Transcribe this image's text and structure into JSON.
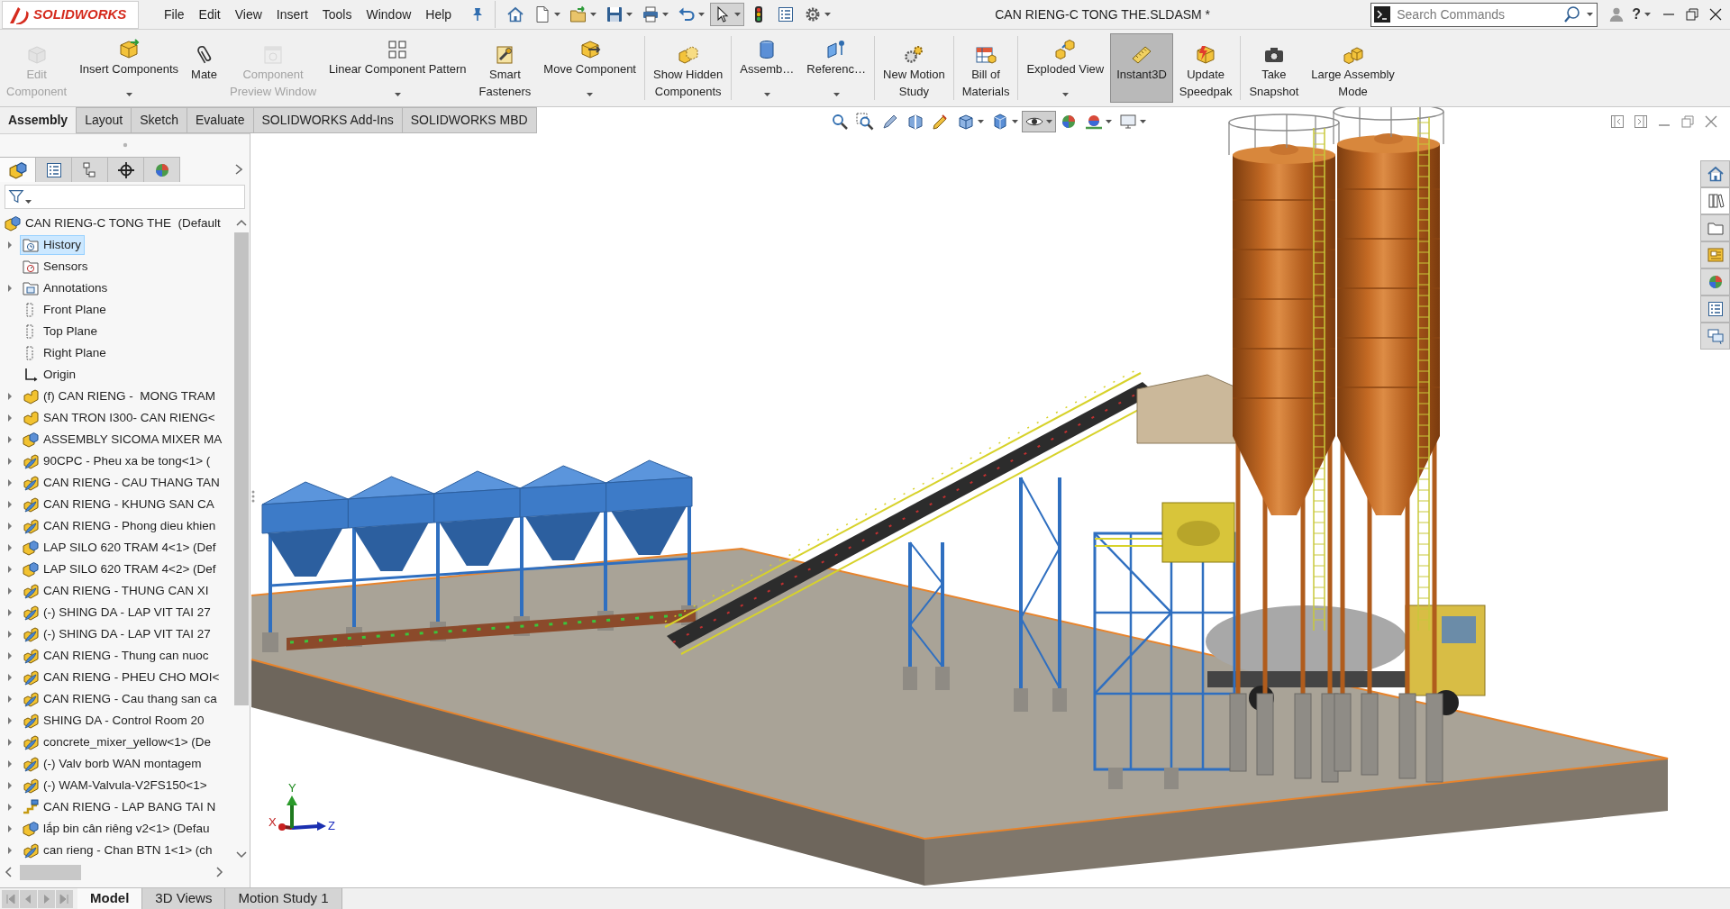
{
  "app": {
    "logo": "SOLIDWORKS",
    "menu": [
      "File",
      "Edit",
      "View",
      "Insert",
      "Tools",
      "Window",
      "Help"
    ],
    "title": "CAN RIENG-C TONG THE.SLDASM *",
    "search": {
      "placeholder": "Search Commands"
    },
    "help": "?"
  },
  "quick_access": [
    {
      "selected": false,
      "menu": false
    },
    {
      "selected": false,
      "menu": true
    },
    {
      "selected": false,
      "menu": true
    },
    {
      "selected": false,
      "menu": true
    },
    {
      "selected": false,
      "menu": true
    },
    {
      "selected": false,
      "menu": true
    },
    {
      "selected": true,
      "menu": true
    },
    {
      "selected": false,
      "menu": false
    },
    {
      "selected": false,
      "menu": false
    },
    {
      "selected": false,
      "menu": true
    }
  ],
  "ribbon": {
    "groups": [
      [
        {
          "label": "Edit\nComponent",
          "disabled": true,
          "selected": false,
          "menu": false
        },
        {
          "label": "Insert Components",
          "disabled": false,
          "selected": false,
          "menu": true
        },
        {
          "label": "Mate",
          "disabled": false,
          "selected": false,
          "menu": false
        },
        {
          "label": "Component\nPreview Window",
          "disabled": true,
          "selected": false,
          "menu": false
        },
        {
          "label": "Linear Component Pattern",
          "disabled": false,
          "selected": false,
          "menu": true
        },
        {
          "label": "Smart\nFasteners",
          "disabled": false,
          "selected": false,
          "menu": false
        },
        {
          "label": "Move Component",
          "disabled": false,
          "selected": false,
          "menu": true
        }
      ],
      [
        {
          "label": "Show Hidden\nComponents",
          "disabled": false,
          "selected": false,
          "menu": false
        }
      ],
      [
        {
          "label": "Assemb…",
          "disabled": false,
          "selected": false,
          "menu": true
        },
        {
          "label": "Referenc…",
          "disabled": false,
          "selected": false,
          "menu": true
        }
      ],
      [
        {
          "label": "New Motion\nStudy",
          "disabled": false,
          "selected": false,
          "menu": false
        }
      ],
      [
        {
          "label": "Bill of\nMaterials",
          "disabled": false,
          "selected": false,
          "menu": false
        }
      ],
      [
        {
          "label": "Exploded View",
          "disabled": false,
          "selected": false,
          "menu": true
        },
        {
          "label": "Instant3D",
          "disabled": false,
          "selected": true,
          "menu": false
        },
        {
          "label": "Update\nSpeedpak",
          "disabled": false,
          "selected": false,
          "menu": false
        }
      ],
      [
        {
          "label": "Take\nSnapshot",
          "disabled": false,
          "selected": false,
          "menu": false
        },
        {
          "label": "Large Assembly\nMode",
          "disabled": false,
          "selected": false,
          "menu": false
        }
      ]
    ],
    "tabs": [
      {
        "label": "Assembly",
        "selected": true
      },
      {
        "label": "Layout",
        "selected": false
      },
      {
        "label": "Sketch",
        "selected": false
      },
      {
        "label": "Evaluate",
        "selected": false
      },
      {
        "label": "SOLIDWORKS Add-Ins",
        "selected": false
      },
      {
        "label": "SOLIDWORKS MBD",
        "selected": false
      }
    ]
  },
  "view_toolbar": [
    {
      "selected": false,
      "menu": false
    },
    {
      "selected": false,
      "menu": false
    },
    {
      "selected": false,
      "menu": false
    },
    {
      "selected": false,
      "menu": false
    },
    {
      "selected": false,
      "menu": false
    },
    {
      "selected": false,
      "menu": true
    },
    {
      "selected": false,
      "menu": true
    },
    {
      "selected": true,
      "menu": true
    },
    {
      "selected": false,
      "menu": false
    },
    {
      "selected": false,
      "menu": true
    },
    {
      "selected": false,
      "menu": true
    }
  ],
  "feature_panel": {
    "tabs": [
      {
        "selected": true
      },
      {
        "selected": false
      },
      {
        "selected": false
      },
      {
        "selected": false
      },
      {
        "selected": false
      }
    ],
    "tree": {
      "label": "CAN RIENG-C TONG THE  (Default",
      "kind": "assembly",
      "expandable": false,
      "selected": false,
      "children": [
        {
          "label": "History",
          "kind": "history",
          "expandable": true,
          "selected": true
        },
        {
          "label": "Sensors",
          "kind": "sensors",
          "expandable": false,
          "selected": false
        },
        {
          "label": "Annotations",
          "kind": "annotations",
          "expandable": true,
          "selected": false
        },
        {
          "label": "Front Plane",
          "kind": "plane",
          "expandable": false,
          "selected": false
        },
        {
          "label": "Top Plane",
          "kind": "plane",
          "expandable": false,
          "selected": false
        },
        {
          "label": "Right Plane",
          "kind": "plane",
          "expandable": false,
          "selected": false
        },
        {
          "label": "Origin",
          "kind": "origin",
          "expandable": false,
          "selected": false
        },
        {
          "label": "(f) CAN RIENG -  MONG TRAM",
          "kind": "part",
          "expandable": true,
          "selected": false
        },
        {
          "label": "SAN TRON I300- CAN RIENG<",
          "kind": "part",
          "expandable": true,
          "selected": false
        },
        {
          "label": "ASSEMBLY SICOMA MIXER MA",
          "kind": "assembly",
          "expandable": true,
          "selected": false
        },
        {
          "label": "90CPC - Pheu xa be tong<1> (",
          "kind": "subassembly",
          "expandable": true,
          "selected": false
        },
        {
          "label": "CAN RIENG - CAU THANG TAN",
          "kind": "subassembly",
          "expandable": true,
          "selected": false
        },
        {
          "label": "CAN RIENG - KHUNG SAN CA",
          "kind": "subassembly",
          "expandable": true,
          "selected": false
        },
        {
          "label": "CAN RIENG - Phong dieu khien",
          "kind": "subassembly",
          "expandable": true,
          "selected": false
        },
        {
          "label": "LAP SILO 620 TRAM 4<1> (Def",
          "kind": "assembly",
          "expandable": true,
          "selected": false
        },
        {
          "label": "LAP SILO 620 TRAM 4<2> (Def",
          "kind": "assembly",
          "expandable": true,
          "selected": false
        },
        {
          "label": "CAN RIENG - THUNG CAN XI",
          "kind": "subassembly",
          "expandable": true,
          "selected": false
        },
        {
          "label": "(-) SHING DA - LAP VIT TAI 27",
          "kind": "subassembly",
          "expandable": true,
          "selected": false
        },
        {
          "label": "(-) SHING DA - LAP VIT TAI 27",
          "kind": "subassembly",
          "expandable": true,
          "selected": false
        },
        {
          "label": "CAN RIENG - Thung can nuoc",
          "kind": "subassembly",
          "expandable": true,
          "selected": false
        },
        {
          "label": "CAN RIENG - PHEU CHO MOI<",
          "kind": "subassembly",
          "expandable": true,
          "selected": false
        },
        {
          "label": "CAN RIENG - Cau thang san ca",
          "kind": "subassembly",
          "expandable": true,
          "selected": false
        },
        {
          "label": "SHING DA - Control Room 20",
          "kind": "subassembly",
          "expandable": true,
          "selected": false
        },
        {
          "label": "concrete_mixer_yellow<1> (De",
          "kind": "subassembly",
          "expandable": true,
          "selected": false
        },
        {
          "label": "(-) Valv borb WAN montagem",
          "kind": "subassembly",
          "expandable": true,
          "selected": false
        },
        {
          "label": "(-) WAM-Valvula-V2FS150<1>",
          "kind": "subassembly",
          "expandable": true,
          "selected": false
        },
        {
          "label": "CAN RIENG - LAP BANG TAI N",
          "kind": "layout",
          "expandable": true,
          "selected": false
        },
        {
          "label": "lắp bin cân riêng v2<1> (Defau",
          "kind": "assembly",
          "expandable": true,
          "selected": false
        },
        {
          "label": "can rieng - Chan BTN 1<1> (ch",
          "kind": "subassembly",
          "expandable": true,
          "selected": false
        }
      ]
    }
  },
  "task_pane": [
    {
      "selected": false
    },
    {
      "selected": true
    },
    {
      "selected": false
    },
    {
      "selected": false
    },
    {
      "selected": false
    },
    {
      "selected": false
    },
    {
      "selected": false
    }
  ],
  "viewport": {
    "triad": [
      "X",
      "Y",
      "Z"
    ]
  },
  "bottom_tabs": [
    {
      "label": "Model",
      "selected": true
    },
    {
      "label": "3D Views",
      "selected": false
    },
    {
      "label": "Motion Study 1",
      "selected": false
    }
  ]
}
